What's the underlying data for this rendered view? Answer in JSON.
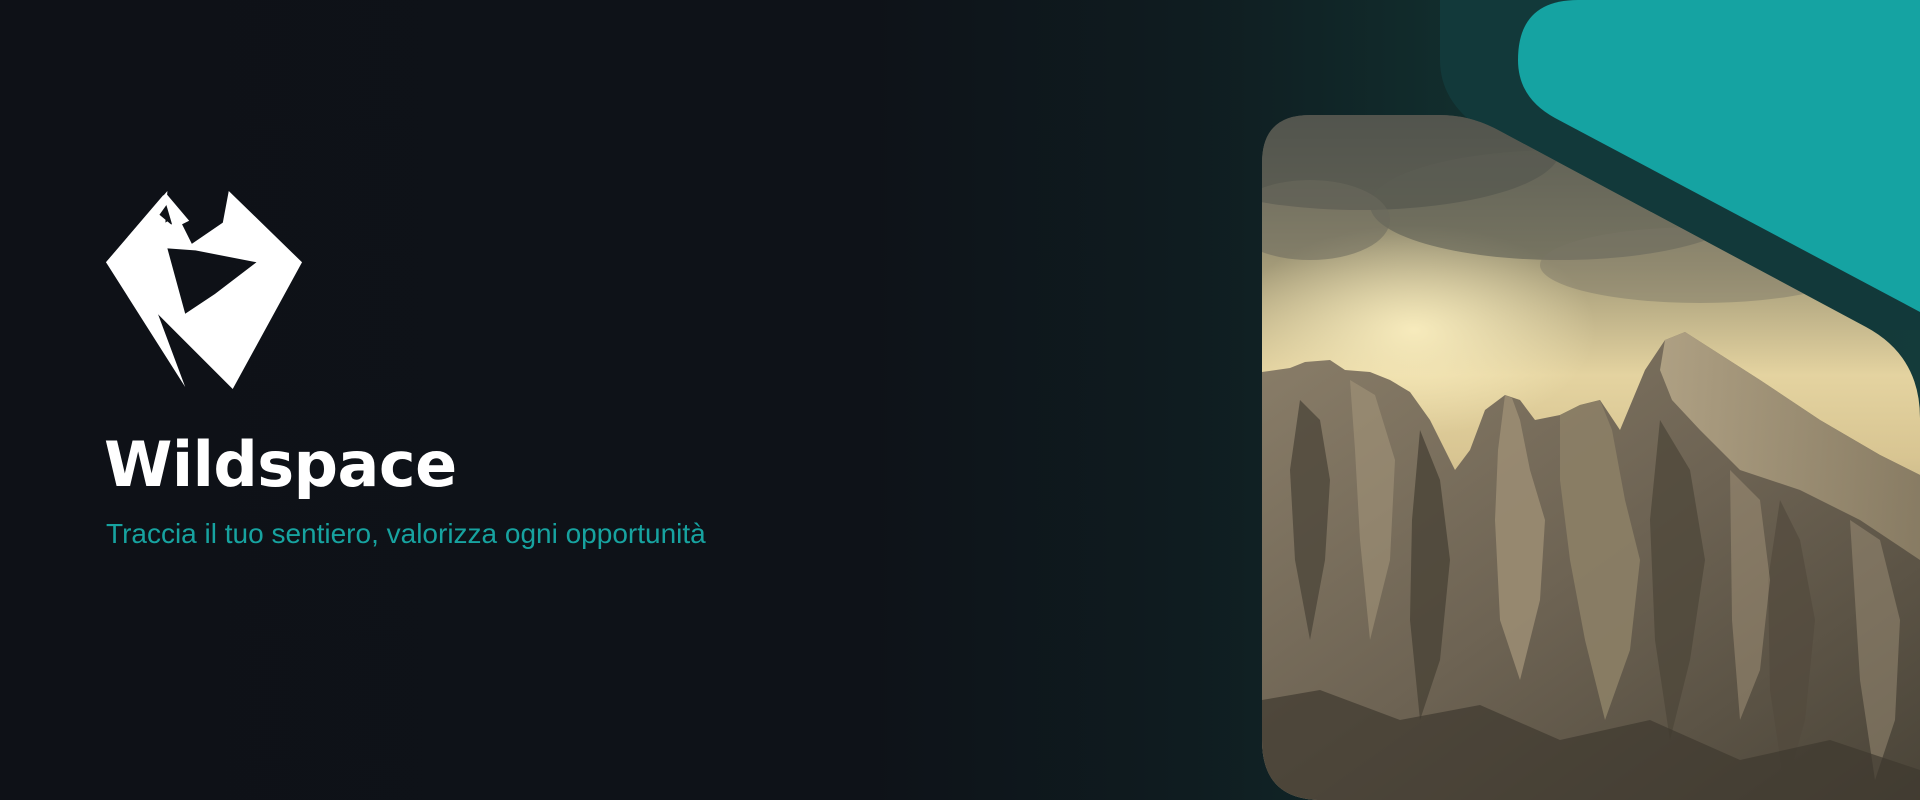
{
  "brand": {
    "name": "Wildspace",
    "tagline": "Traccia il tuo sentiero, valorizza ogni opportunità",
    "logo_icon": "geometric-diamond-mountain-logo"
  },
  "hero_image": {
    "subject": "mountain-peaks-cloudy-sky-photo"
  },
  "colors": {
    "background": "#0e1117",
    "accent_teal": "#15a3a2",
    "dark_teal": "#12393a",
    "text_primary": "#ffffff",
    "tagline": "#17a3a0"
  }
}
